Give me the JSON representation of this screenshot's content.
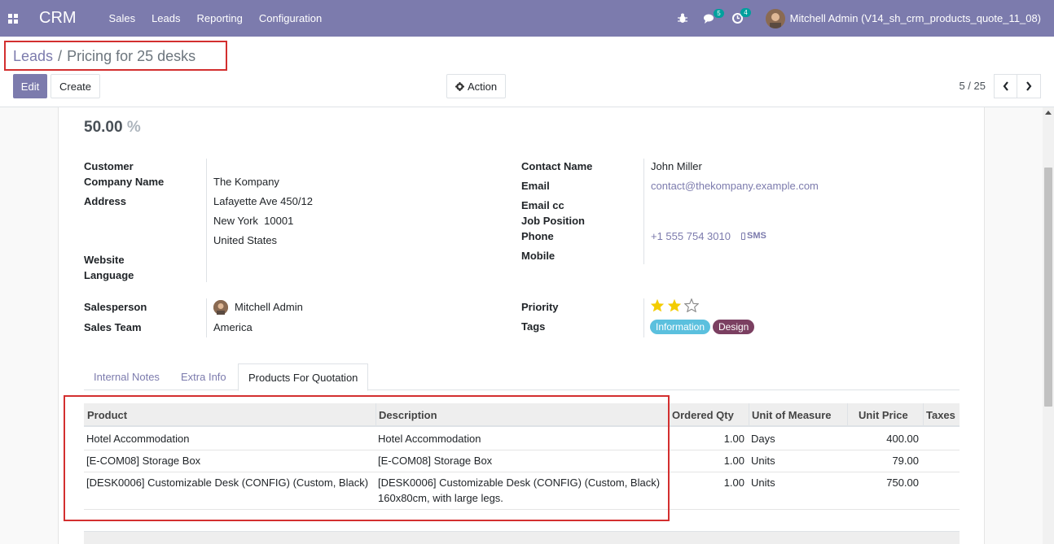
{
  "navbar": {
    "brand": "CRM",
    "menu": [
      "Sales",
      "Leads",
      "Reporting",
      "Configuration"
    ],
    "chat_count": "5",
    "activity_count": "4",
    "user": "Mitchell Admin (V14_sh_crm_products_quote_11_08)"
  },
  "breadcrumb": {
    "parent": "Leads",
    "separator": "/",
    "current": "Pricing for 25 desks"
  },
  "toolbar": {
    "edit_label": "Edit",
    "create_label": "Create",
    "action_label": "Action",
    "pager": "5 / 25"
  },
  "form": {
    "probability": "50.00",
    "probability_unit": "%",
    "left": {
      "customer_label": "Customer",
      "company_label": "Company Name",
      "company_value": "The Kompany",
      "address_label": "Address",
      "street": "Lafayette Ave 450/12",
      "city_zip": "New York  10001",
      "country": "United States",
      "website_label": "Website",
      "language_label": "Language",
      "salesperson_label": "Salesperson",
      "salesperson_value": "Mitchell Admin",
      "team_label": "Sales Team",
      "team_value": "America"
    },
    "right": {
      "contact_label": "Contact Name",
      "contact_value": "John Miller",
      "email_label": "Email",
      "email_value": "contact@thekompany.example.com",
      "emailcc_label": "Email cc",
      "job_label": "Job Position",
      "phone_label": "Phone",
      "phone_value": "+1 555 754 3010",
      "sms_label": "SMS",
      "mobile_label": "Mobile",
      "priority_label": "Priority",
      "priority_stars": 2,
      "priority_max": 3,
      "tags_label": "Tags",
      "tags": [
        {
          "label": "Information",
          "color": "#5bc0de"
        },
        {
          "label": "Design",
          "color": "#7b3f61"
        }
      ]
    }
  },
  "tabs": [
    "Internal Notes",
    "Extra Info",
    "Products For Quotation"
  ],
  "active_tab": "Products For Quotation",
  "table": {
    "headers": [
      "Product",
      "Description",
      "Ordered Qty",
      "Unit of Measure",
      "Unit Price",
      "Taxes"
    ],
    "rows": [
      {
        "product": "Hotel Accommodation",
        "description": "Hotel Accommodation",
        "description2": "",
        "qty": "1.00",
        "uom": "Days",
        "price": "400.00",
        "taxes": ""
      },
      {
        "product": "[E-COM08] Storage Box",
        "description": "[E-COM08] Storage Box",
        "description2": "",
        "qty": "1.00",
        "uom": "Units",
        "price": "79.00",
        "taxes": ""
      },
      {
        "product": "[DESK0006] Customizable Desk (CONFIG) (Custom, Black)",
        "description": "[DESK0006] Customizable Desk (CONFIG) (Custom, Black)",
        "description2": "160x80cm, with large legs.",
        "qty": "1.00",
        "uom": "Units",
        "price": "750.00",
        "taxes": ""
      }
    ]
  },
  "colors": {
    "brand": "#7c7bad",
    "highlight": "#d32f2f",
    "star": "#f3cc00"
  }
}
